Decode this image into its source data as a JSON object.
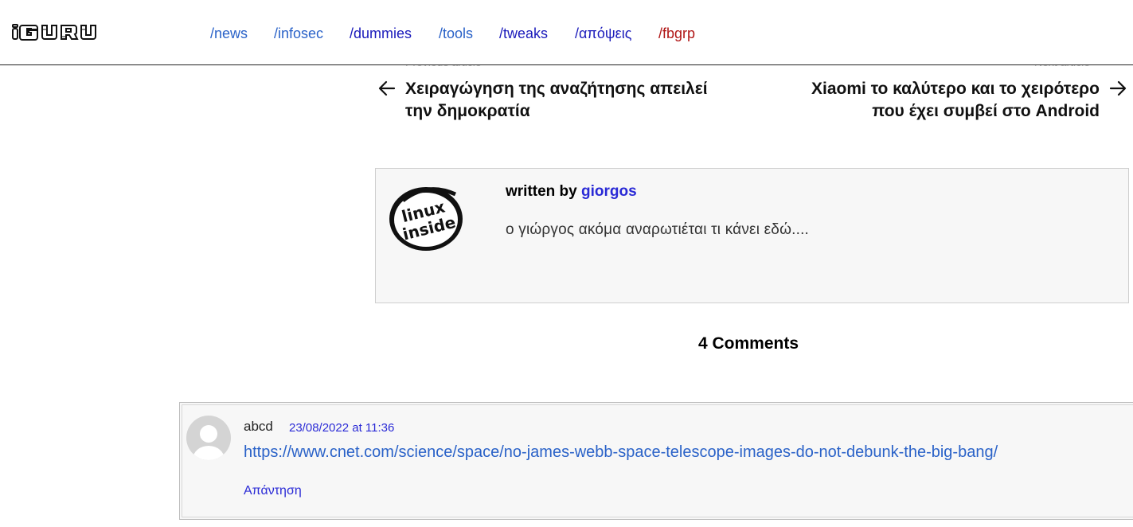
{
  "header": {
    "logo_text": "iGUR U",
    "nav": [
      {
        "label": "/news",
        "color": "#2a62c8"
      },
      {
        "label": "/infosec",
        "color": "#2a62c8"
      },
      {
        "label": "/dummies",
        "color": "#1b1bbb"
      },
      {
        "label": "/tools",
        "color": "#2a62c8"
      },
      {
        "label": "/tweaks",
        "color": "#1b1bbb"
      },
      {
        "label": "/απόψεις",
        "color": "#1b1bbb"
      },
      {
        "label": "/fbgrp",
        "color": "#b01515"
      }
    ]
  },
  "post_nav": {
    "previous_label": "Previous article",
    "previous_title_line1": "Χειραγώγηση της αναζήτησης απειλεί",
    "previous_title_line2": "την δημοκρατία",
    "next_label": "Next article",
    "next_title_line1": "Xiaomi το καλύτερο και το χειρότερο",
    "next_title_line2": "που έχει συμβεί στο Android"
  },
  "author": {
    "written_by": "written by",
    "name": "giorgos",
    "avatar_text_1": "linux",
    "avatar_text_2": "inside",
    "bio": "ο γιώργος ακόμα αναρωτιέται τι κάνει εδώ...."
  },
  "comments": {
    "heading": "4 Comments",
    "items": [
      {
        "author": "abcd",
        "date": "23/08/2022 at 11:36",
        "link": "https://www.cnet.com/science/space/no-james-webb-space-telescope-images-do-not-debunk-the-big-bang/",
        "reply": "Απάντηση"
      }
    ]
  }
}
